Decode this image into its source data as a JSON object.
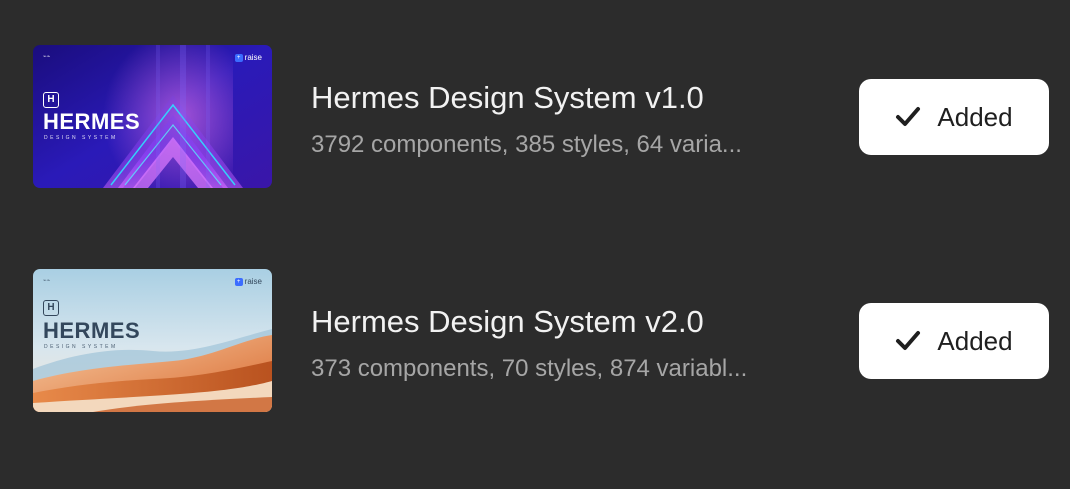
{
  "libraries": [
    {
      "title": "Hermes Design System v1.0",
      "description": "3792 components, 385 styles, 64 varia...",
      "button_label": "Added",
      "button_icon": "checkmark-icon",
      "thumbnail": {
        "logo_letter": "H",
        "title": "HERMES",
        "subtitle": "DESIGN SYSTEM",
        "brand": "raise",
        "theme": "dark-purple-chevrons",
        "colors": [
          "#1b0f8f",
          "#3d2bd6",
          "#8b2ee8",
          "#21d0ff"
        ]
      }
    },
    {
      "title": "Hermes Design System v2.0",
      "description": "373 components, 70 styles, 874 variabl...",
      "button_label": "Added",
      "button_icon": "checkmark-icon",
      "thumbnail": {
        "logo_letter": "H",
        "title": "HERMES",
        "subtitle": "DESIGN SYSTEM",
        "brand": "raise",
        "theme": "light-desert-dunes",
        "colors": [
          "#b8d6e6",
          "#e9ddd0",
          "#d9743a",
          "#f4c49b"
        ]
      }
    }
  ],
  "colors": {
    "background": "#2c2c2c",
    "title_text": "#f2f2f2",
    "description_text": "#a6a6a6",
    "button_background": "#ffffff",
    "button_text": "#1f1f1f"
  }
}
